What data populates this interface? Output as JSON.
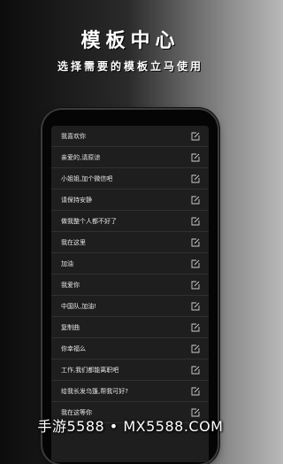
{
  "header": {
    "title": "模板中心",
    "subtitle": "选择需要的模板立马使用"
  },
  "templates": [
    {
      "label": "我喜欢你",
      "icon": "edit-icon"
    },
    {
      "label": "亲爱的,请原谅",
      "icon": "edit-icon"
    },
    {
      "label": "小姐姐,加个微信吧",
      "icon": "edit-icon"
    },
    {
      "label": "请保持安静",
      "icon": "edit-icon"
    },
    {
      "label": "做我整个人都不好了",
      "icon": "edit-icon"
    },
    {
      "label": "我在这里",
      "icon": "edit-icon"
    },
    {
      "label": "加油",
      "icon": "edit-icon"
    },
    {
      "label": "我爱你",
      "icon": "edit-icon"
    },
    {
      "label": "中国队,加油!",
      "icon": "edit-icon"
    },
    {
      "label": "复制曲",
      "icon": "edit-icon"
    },
    {
      "label": "你幸福么",
      "icon": "edit-icon"
    },
    {
      "label": "工作,我们都能离职吧",
      "icon": "edit-icon"
    },
    {
      "label": "给我长发乌篷,帮我可好?",
      "icon": "edit-icon"
    },
    {
      "label": "我在这等你",
      "icon": "edit-icon"
    }
  ],
  "watermark": {
    "text": "手游5588 • MX5588.COM"
  },
  "colors": {
    "list_background": "#1e1e1e",
    "divider": "#303030",
    "text": "#e6e6e6"
  }
}
